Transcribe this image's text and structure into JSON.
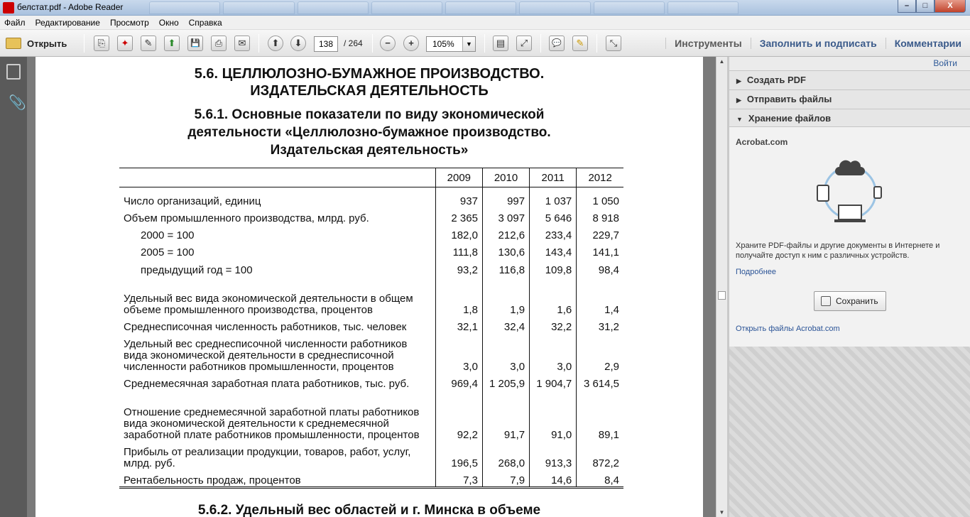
{
  "window": {
    "title": "белстат.pdf - Adobe Reader",
    "min": "–",
    "max": "□",
    "close": "X"
  },
  "menu": [
    "Файл",
    "Редактирование",
    "Просмотр",
    "Окно",
    "Справка"
  ],
  "toolbar": {
    "open_label": "Открыть",
    "page_current": "138",
    "page_total": "/ 264",
    "zoom": "105%",
    "zoom_dd": "▼",
    "tools": "Инструменты",
    "fill_sign": "Заполнить и подписать",
    "comments": "Комментарии",
    "icons": {
      "create": "⎘",
      "pdf": "✦",
      "edit": "✎",
      "upload": "⬆",
      "save": "💾",
      "print": "⎙",
      "mail": "✉",
      "prev": "⬆",
      "next": "⬇",
      "zoom_out": "−",
      "zoom_in": "+",
      "fit_page": "▤",
      "fit_width": "⤢",
      "comment": "💬",
      "highlight": "✎",
      "expand": "⤡"
    }
  },
  "leftnav": {
    "attach": "📎"
  },
  "scroll": {
    "up": "▲",
    "down": "▼"
  },
  "document": {
    "title1": "5.6. ЦЕЛЛЮЛОЗНО-БУМАЖНОЕ ПРОИЗВОДСТВО.",
    "title2": "ИЗДАТЕЛЬСКАЯ ДЕЯТЕЛЬНОСТЬ",
    "sub1": "5.6.1. Основные показатели по виду экономической",
    "sub2": "деятельности «Целлюлозно-бумажное производство.",
    "sub3": "Издательская деятельность»",
    "years": [
      "2009",
      "2010",
      "2011",
      "2012"
    ],
    "rows": [
      {
        "label": "Число организаций, единиц",
        "v": [
          "937",
          "997",
          "1 037",
          "1 050"
        ]
      },
      {
        "label": "Объем промышленного производства, млрд. руб.",
        "v": [
          "2 365",
          "3 097",
          "5 646",
          "8 918"
        ]
      },
      {
        "label": "2000 = 100",
        "v": [
          "182,0",
          "212,6",
          "233,4",
          "229,7"
        ]
      },
      {
        "label": "2005 = 100",
        "v": [
          "111,8",
          "130,6",
          "143,4",
          "141,1"
        ]
      },
      {
        "label": "предыдущий год = 100",
        "v": [
          "93,2",
          "116,8",
          "109,8",
          "98,4"
        ]
      },
      {
        "label": "Удельный вес вида экономической деятельности в общем объеме промышленного производства, процентов",
        "v": [
          "1,8",
          "1,9",
          "1,6",
          "1,4"
        ]
      },
      {
        "label": "Среднесписочная численность работников, тыс. человек",
        "v": [
          "32,1",
          "32,4",
          "32,2",
          "31,2"
        ]
      },
      {
        "label": "Удельный вес среднесписочной численности работников вида экономической деятельности в среднесписочной численности работников промышленности, процентов",
        "v": [
          "3,0",
          "3,0",
          "3,0",
          "2,9"
        ]
      },
      {
        "label": "Среднемесячная заработная плата работников, тыс. руб.",
        "v": [
          "969,4",
          "1 205,9",
          "1 904,7",
          "3 614,5"
        ]
      },
      {
        "label": "Отношение среднемесячной заработной платы работников вида экономической деятельности к среднемесячной заработной плате работников промышленности, процентов",
        "v": [
          "92,2",
          "91,7",
          "91,0",
          "89,1"
        ]
      },
      {
        "label": "Прибыль от реализации продукции, товаров, работ, услуг, млрд. руб.",
        "v": [
          "196,5",
          "268,0",
          "913,3",
          "872,2"
        ]
      },
      {
        "label": "Рентабельность продаж, процентов",
        "v": [
          "7,3",
          "7,9",
          "14,6",
          "8,4"
        ]
      }
    ],
    "next_heading": "5.6.2. Удельный вес областей и г. Минска в объеме"
  },
  "panel": {
    "signin": "Войти",
    "create_pdf": "Создать PDF",
    "send_files": "Отправить файлы",
    "storage": "Хранение файлов",
    "acrobat": "Acrobat.com",
    "desc": "Храните PDF-файлы и другие документы в Интернете и получайте доступ к ним с различных устройств.",
    "more": "Подробнее",
    "save": "Сохранить",
    "open_files": "Открыть файлы Acrobat.com",
    "tri_closed": "▶",
    "tri_open": "▼"
  }
}
